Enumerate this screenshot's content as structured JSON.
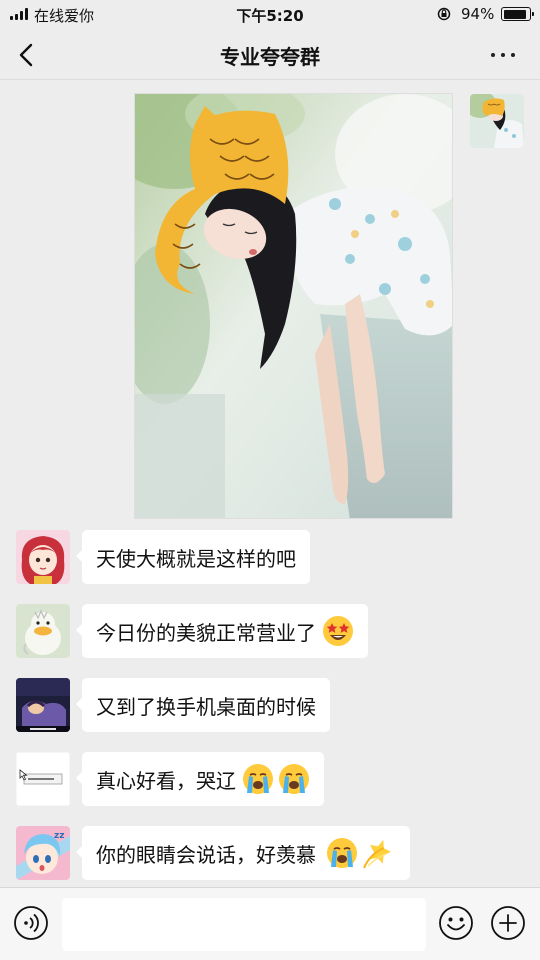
{
  "status": {
    "carrier": "在线爱你",
    "time": "下午5:20",
    "battery": "94%",
    "battery_level": 0.94
  },
  "nav": {
    "title": "专业夸夸群",
    "back_icon": "chevron-left-icon",
    "more_icon": "more-dots-icon"
  },
  "messages": [
    {
      "text": "天使大概就是这样的吧",
      "emojis": []
    },
    {
      "text": "今日份的美貌正常营业了",
      "emojis": [
        "star-struck"
      ]
    },
    {
      "text": "又到了换手机桌面的时候",
      "emojis": []
    },
    {
      "text": "真心好看，哭辽",
      "emojis": [
        "loudly-crying",
        "loudly-crying"
      ]
    },
    {
      "text": "你的眼睛会说话，好羡慕",
      "emojis": [
        "loudly-crying",
        "dizzy"
      ]
    }
  ],
  "input": {
    "value": "",
    "voice_icon": "voice-icon",
    "emoji_icon": "emoji-icon",
    "plus_icon": "plus-icon"
  }
}
